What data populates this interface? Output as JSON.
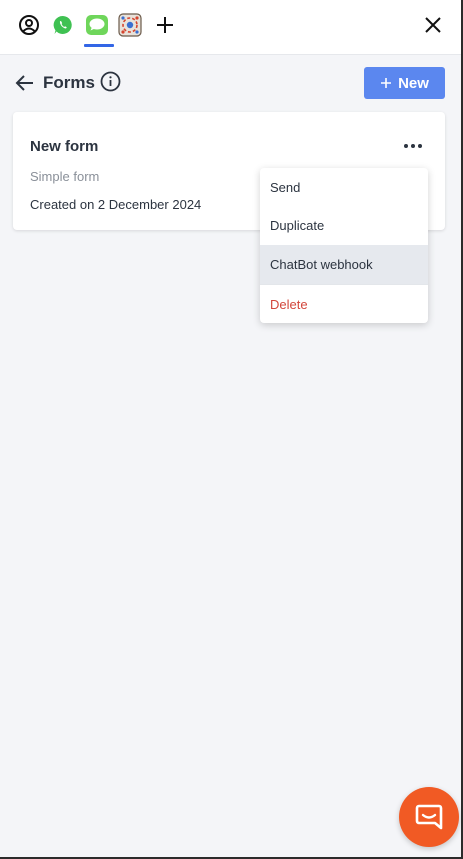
{
  "tabs": [
    {
      "icon": "account-circle-icon"
    },
    {
      "icon": "whatsapp-icon"
    },
    {
      "icon": "imessage-icon",
      "active": true
    },
    {
      "icon": "integration-app-icon"
    },
    {
      "icon": "add-tab-icon"
    }
  ],
  "header": {
    "title": "Forms",
    "new_button_label": "New"
  },
  "form_card": {
    "title": "New form",
    "subtitle": "Simple form",
    "created": "Created on 2 December 2024"
  },
  "menu": {
    "items": [
      {
        "label": "Send"
      },
      {
        "label": "Duplicate"
      },
      {
        "label": "ChatBot webhook",
        "hover": true
      },
      {
        "label": "Delete",
        "danger": true
      }
    ]
  },
  "colors": {
    "accent": "#5b87ef",
    "active_tab": "#3366e6",
    "danger": "#d2473c",
    "chat": "#f15a24",
    "whatsapp": "#3fc152",
    "imessage": "#6fd65b"
  }
}
